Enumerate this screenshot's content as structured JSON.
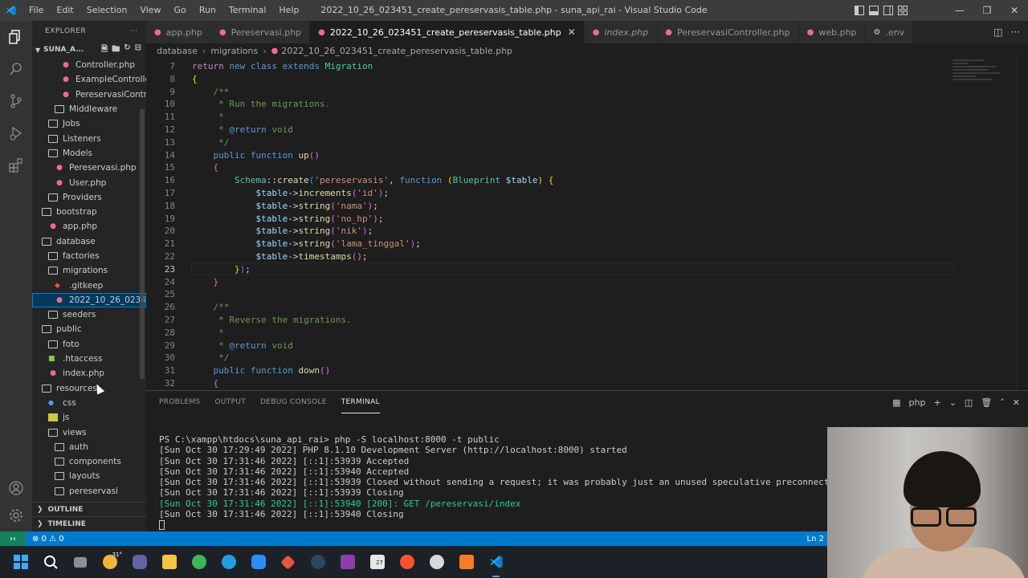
{
  "window": {
    "title": "2022_10_26_023451_create_pereservasis_table.php - suna_api_rai - Visual Studio Code",
    "menu": [
      "File",
      "Edit",
      "Selection",
      "View",
      "Go",
      "Run",
      "Terminal",
      "Help"
    ]
  },
  "explorer": {
    "header": "EXPLORER",
    "project": "SUNA_A...",
    "tree": [
      {
        "label": "Controller.php",
        "type": "php",
        "level": 3
      },
      {
        "label": "ExampleControlle...",
        "type": "php",
        "level": 3
      },
      {
        "label": "PereservasiContr...",
        "type": "php",
        "level": 3
      },
      {
        "label": "Middleware",
        "type": "folder",
        "level": 2
      },
      {
        "label": "Jobs",
        "type": "folder",
        "level": 1
      },
      {
        "label": "Listeners",
        "type": "folder",
        "level": 1
      },
      {
        "label": "Models",
        "type": "folder",
        "level": 1
      },
      {
        "label": "Pereservasi.php",
        "type": "php",
        "level": 2
      },
      {
        "label": "User.php",
        "type": "php",
        "level": 2
      },
      {
        "label": "Providers",
        "type": "folder",
        "level": 1
      },
      {
        "label": "bootstrap",
        "type": "folder",
        "level": 0
      },
      {
        "label": "app.php",
        "type": "php",
        "level": 1
      },
      {
        "label": "database",
        "type": "folder",
        "level": 0
      },
      {
        "label": "factories",
        "type": "folder",
        "level": 1
      },
      {
        "label": "migrations",
        "type": "folder",
        "level": 1
      },
      {
        "label": ".gitkeep",
        "type": "git",
        "level": 2
      },
      {
        "label": "2022_10_26_02345...",
        "type": "php",
        "level": 2,
        "selected": true
      },
      {
        "label": "seeders",
        "type": "folder",
        "level": 1
      },
      {
        "label": "public",
        "type": "folder",
        "level": 0
      },
      {
        "label": "foto",
        "type": "folder",
        "level": 1
      },
      {
        "label": ".htaccess",
        "type": "ht",
        "level": 1
      },
      {
        "label": "index.php",
        "type": "php",
        "level": 1
      },
      {
        "label": "resources",
        "type": "folder",
        "level": 0
      },
      {
        "label": "css",
        "type": "css",
        "level": 1
      },
      {
        "label": "js",
        "type": "js",
        "level": 1
      },
      {
        "label": "views",
        "type": "folder",
        "level": 1
      },
      {
        "label": "auth",
        "type": "folder",
        "level": 2
      },
      {
        "label": "components",
        "type": "folder",
        "level": 2
      },
      {
        "label": "layouts",
        "type": "folder",
        "level": 2
      },
      {
        "label": "pereservasi",
        "type": "folder",
        "level": 2
      }
    ],
    "outline": "OUTLINE",
    "timeline": "TIMELINE"
  },
  "tabs": [
    {
      "label": "app.php",
      "active": false
    },
    {
      "label": "Pereservasi.php",
      "active": false
    },
    {
      "label": "2022_10_26_023451_create_pereservasis_table.php",
      "active": true
    },
    {
      "label": "index.php",
      "active": false
    },
    {
      "label": "PereservasiController.php",
      "active": false
    },
    {
      "label": "web.php",
      "active": false
    },
    {
      "label": ".env",
      "active": false
    }
  ],
  "breadcrumb": [
    "database",
    "migrations",
    "2022_10_26_023451_create_pereservasis_table.php"
  ],
  "editor": {
    "line_numbers": [
      "7",
      "8",
      "9",
      "10",
      "11",
      "12",
      "13",
      "14",
      "15",
      "16",
      "17",
      "18",
      "19",
      "20",
      "21",
      "22",
      "23",
      "24",
      "25",
      "26",
      "27",
      "28",
      "29",
      "30",
      "31",
      "32"
    ],
    "current_line": "23"
  },
  "panel": {
    "tabs": [
      "PROBLEMS",
      "OUTPUT",
      "DEBUG CONSOLE",
      "TERMINAL"
    ],
    "active_tab": "TERMINAL",
    "shell": "php",
    "terminal": [
      "PS C:\\xampp\\htdocs\\suna_api_rai> php -S localhost:8000 -t public",
      "[Sun Oct 30 17:29:49 2022] PHP 8.1.10 Development Server (http://localhost:8000) started",
      "[Sun Oct 30 17:31:46 2022] [::1]:53939 Accepted",
      "[Sun Oct 30 17:31:46 2022] [::1]:53940 Accepted",
      "[Sun Oct 30 17:31:46 2022] [::1]:53939 Closed without sending a request; it was probably just an unused speculative preconnection",
      "[Sun Oct 30 17:31:46 2022] [::1]:53939 Closing",
      "[Sun Oct 30 17:31:46 2022] [::1]:53940 [200]: GET /pereservasi/index",
      "[Sun Oct 30 17:31:46 2022] [::1]:53940 Closing"
    ]
  },
  "statusbar": {
    "errors": "⊗ 0 ⚠ 0",
    "position": "Ln 2"
  },
  "taskbar": {
    "weather": "31°",
    "badge": "27"
  }
}
